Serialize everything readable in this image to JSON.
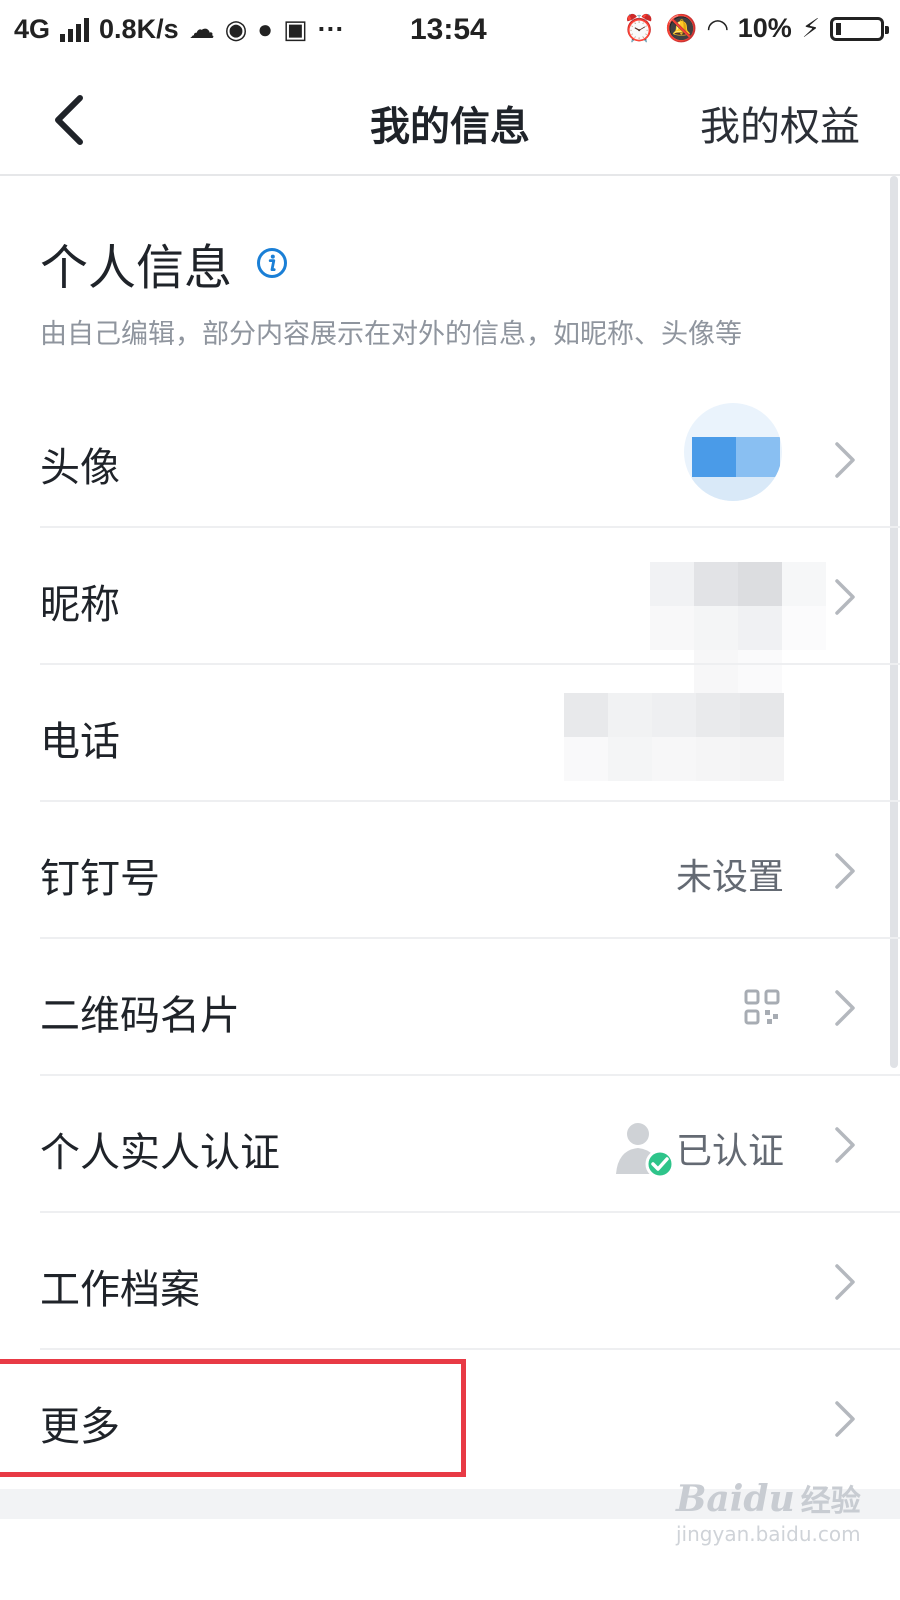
{
  "status_bar": {
    "network": "4G",
    "speed": "0.8K/s",
    "dots": "···",
    "time": "13:54",
    "battery": "10%"
  },
  "nav": {
    "title": "我的信息",
    "right_link": "我的权益"
  },
  "section": {
    "title": "个人信息",
    "description": "由自己编辑，部分内容展示在对外的信息，如昵称、头像等"
  },
  "rows": [
    {
      "label": "头像"
    },
    {
      "label": "昵称"
    },
    {
      "label": "电话"
    },
    {
      "label": "钉钉号",
      "value": "未设置"
    },
    {
      "label": "二维码名片"
    },
    {
      "label": "个人实人认证",
      "value": "已认证"
    },
    {
      "label": "工作档案"
    },
    {
      "label": "更多"
    }
  ],
  "watermark": {
    "brand": "Baidu",
    "sub": "经验",
    "url": "jingyan.baidu.com"
  },
  "colors": {
    "accent": "#1a7fd6",
    "highlight": "#e83a45",
    "verified": "#2ec48a"
  },
  "icons": [
    "back-arrow-icon",
    "info-icon",
    "chevron-right-icon",
    "qr-code-icon",
    "verified-person-icon"
  ]
}
